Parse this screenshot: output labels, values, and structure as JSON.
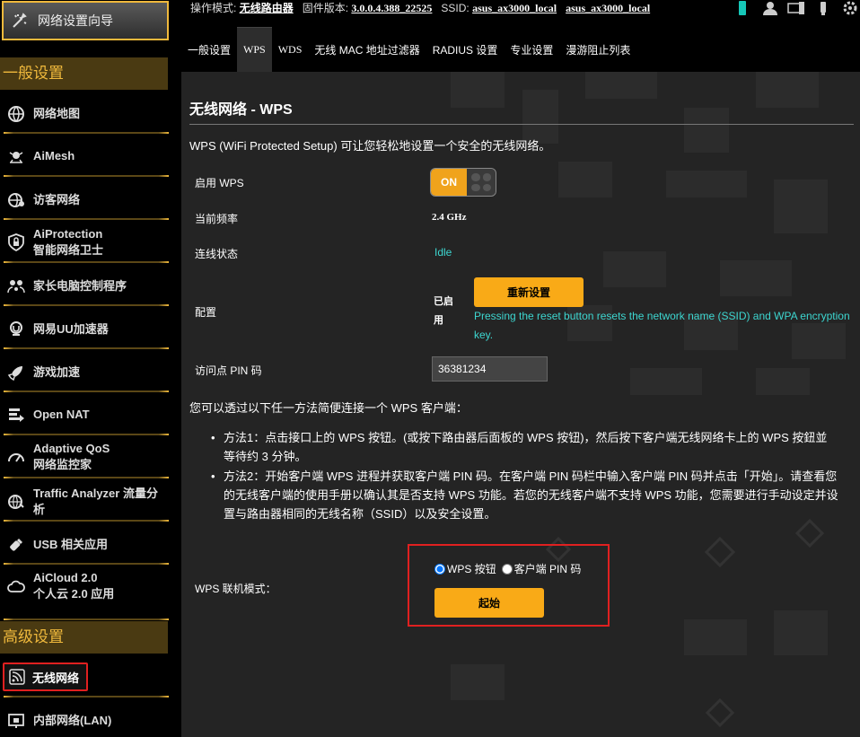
{
  "wizard": {
    "label": "网络设置向导"
  },
  "sections": {
    "general": "一般设置",
    "advanced": "高级设置"
  },
  "nav": [
    {
      "l1": "网络地图"
    },
    {
      "l1": "AiMesh"
    },
    {
      "l1": "访客网络"
    },
    {
      "l1": "AiProtection",
      "l2": "智能网络卫士"
    },
    {
      "l1": "家长电脑控制程序"
    },
    {
      "l1": "网易UU加速器"
    },
    {
      "l1": "游戏加速"
    },
    {
      "l1": "Open NAT"
    },
    {
      "l1": "Adaptive QoS",
      "l2": "网络监控家"
    },
    {
      "l1": "Traffic Analyzer 流量分析"
    },
    {
      "l1": "USB 相关应用"
    },
    {
      "l1": "AiCloud 2.0",
      "l2": "个人云 2.0 应用"
    }
  ],
  "nav_advanced": {
    "wireless": "无线网络",
    "lan": "内部网络(LAN)"
  },
  "topbar": {
    "mode_label": "操作模式:",
    "mode_value": "无线路由器",
    "fw_label": "固件版本:",
    "fw_value": "3.0.0.4.388_22525",
    "ssid_label": "SSID:",
    "ssid1": "asus_ax3000_local",
    "ssid2": "asus_ax3000_local"
  },
  "tabs": [
    "一般设置",
    "WPS",
    "WDS",
    "无线 MAC 地址过滤器",
    "RADIUS 设置",
    "专业设置",
    "漫游阻止列表"
  ],
  "page": {
    "title": "无线网络 - WPS",
    "desc": "WPS (WiFi Protected Setup) 可让您轻松地设置一个安全的无线网络。",
    "enable_label": "启用 WPS",
    "toggle_on": "ON",
    "freq_label": "当前频率",
    "freq_value": "2.4 GHz",
    "status_label": "连线状态",
    "status_value": "Idle",
    "config_label": "配置",
    "config_value_1": "已启",
    "config_value_2": "用",
    "reset_button": "重新设置",
    "reset_hint_1": "Pressing the reset button resets the network name (SSID) and WPA encryption",
    "reset_hint_2": "key.",
    "pin_label": "访问点 PIN 码",
    "pin_value": "36381234",
    "intro": "您可以透过以下任一方法简便连接一个 WPS 客户端：",
    "method1_a": "方法1：点击接口上的 WPS 按钮。(或按下路由器后面板的 WPS 按钮)，然后按下客户端无线网络卡上的 WPS 按鈕並",
    "method1_b": "等待约 3 分钟。",
    "method2_a": "方法2：开始客户端 WPS 进程并获取客户端 PIN 码。在客户端 PIN 码栏中输入客户端 PIN 码并点击「开始」。请查看您",
    "method2_b": "的无线客户端的使用手册以确认其是否支持 WPS 功能。若您的无线客户端不支持 WPS 功能，您需要进行手动设定并设",
    "method2_c": "置与路由器相同的无线名称（SSID）以及安全设置。",
    "mode_label": "WPS 联机模式：",
    "radio_wps": "WPS 按钮",
    "radio_pin": "客户端 PIN 码",
    "start_button": "起始"
  },
  "colors": {
    "accent": "#f9aa17",
    "highlight_border": "#e02020",
    "status_text": "#3dd6d0"
  }
}
